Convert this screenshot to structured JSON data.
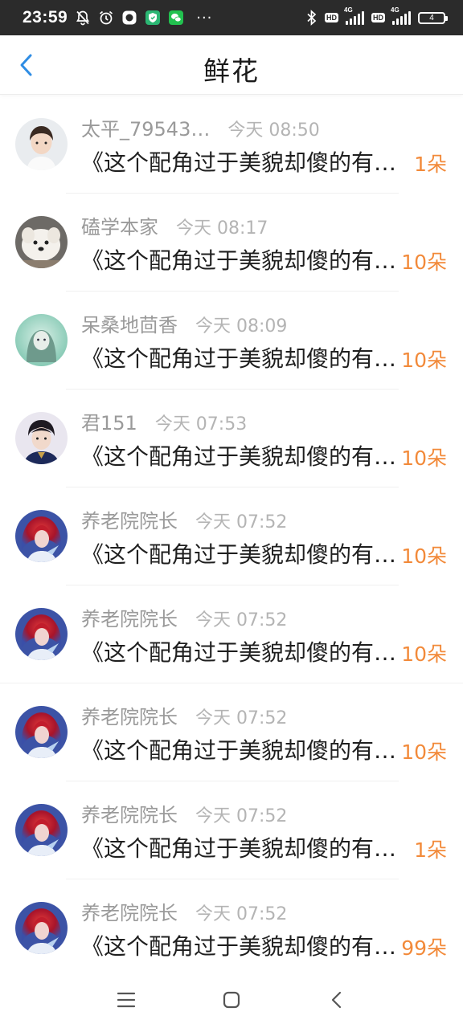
{
  "status_bar": {
    "time": "23:59",
    "hd_label": "HD",
    "network_1": "4G",
    "network_2": "4G",
    "battery": "4"
  },
  "header": {
    "title": "鲜花"
  },
  "records": [
    {
      "username": "太平_79543…",
      "time": "今天 08:50",
      "book": "《这个配角过于美貌却傻的有点可爱》",
      "count": "1朵",
      "avatar": "girl"
    },
    {
      "username": "磕学本家",
      "time": "今天 08:17",
      "book": "《这个配角过于美貌却傻的有点可爱》",
      "count": "10朵",
      "avatar": "dog"
    },
    {
      "username": "呆桑地茴香",
      "time": "今天 08:09",
      "book": "《这个配角过于美貌却傻的有点可爱》",
      "count": "10朵",
      "avatar": "teal-girl"
    },
    {
      "username": "君151",
      "time": "今天 07:53",
      "book": "《这个配角过于美貌却傻的有点可爱》",
      "count": "10朵",
      "avatar": "boy"
    },
    {
      "username": "养老院院长",
      "time": "今天 07:52",
      "book": "《这个配角过于美貌却傻的有点可爱》",
      "count": "10朵",
      "avatar": "red-hair"
    },
    {
      "username": "养老院院长",
      "time": "今天 07:52",
      "book": "《这个配角过于美貌却傻的有点可爱》",
      "count": "10朵",
      "avatar": "red-hair"
    },
    {
      "username": "养老院院长",
      "time": "今天 07:52",
      "book": "《这个配角过于美貌却傻的有点可爱》",
      "count": "10朵",
      "avatar": "red-hair"
    },
    {
      "username": "养老院院长",
      "time": "今天 07:52",
      "book": "《这个配角过于美貌却傻的有点可爱》",
      "count": "1朵",
      "avatar": "red-hair"
    },
    {
      "username": "养老院院长",
      "time": "今天 07:52",
      "book": "《这个配角过于美貌却傻的有点可爱》",
      "count": "99朵",
      "avatar": "red-hair"
    }
  ],
  "colors": {
    "accent": "#f28a3a",
    "back_arrow": "#2f8de4",
    "status_bar_bg": "#2b2b2b"
  },
  "icons": {
    "back": "chevron-left-icon",
    "nav_menu": "menu-icon",
    "nav_home": "home-icon",
    "nav_back": "back-icon"
  }
}
